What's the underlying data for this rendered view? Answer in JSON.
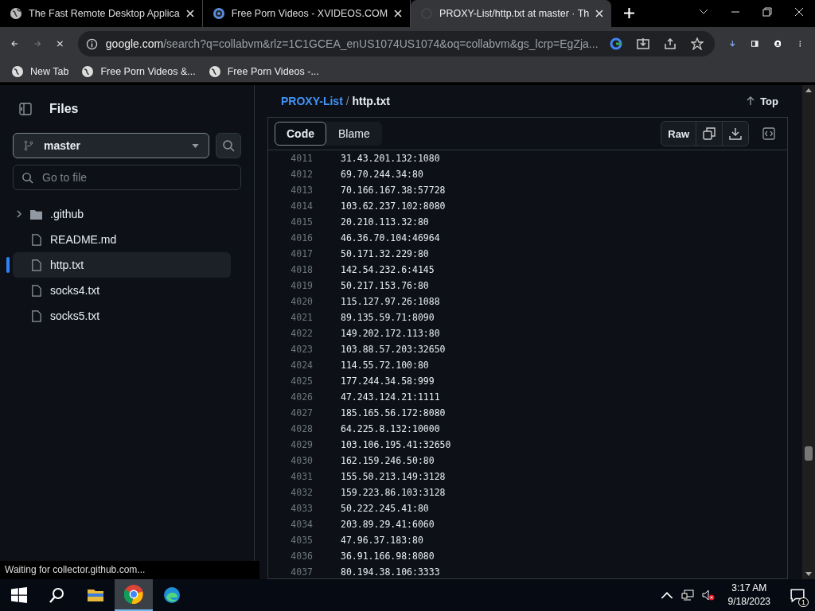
{
  "browser": {
    "tabs": [
      {
        "title": "The Fast Remote Desktop Applica",
        "selected": false,
        "kind": "globe"
      },
      {
        "title": "Free Porn Videos - XVIDEOS.COM",
        "selected": false,
        "kind": "site"
      },
      {
        "title": "PROXY-List/http.txt at master · Th",
        "selected": true,
        "kind": "loading"
      }
    ],
    "address": {
      "host": "google.com",
      "path": "/search?q=collabvm&rlz=1C1GCEA_enUS1074US1074&oq=collabvm&gs_lcrp=EgZja..."
    },
    "bookmarks": [
      "New Tab",
      "Free Porn Videos &...",
      "Free Porn Videos -..."
    ],
    "status": "Waiting for collector.github.com..."
  },
  "sidebar": {
    "title": "Files",
    "branch": "master",
    "search_placeholder": "Go to file",
    "items": [
      {
        "name": ".github",
        "kind": "folder",
        "selected": false,
        "expanded": false
      },
      {
        "name": "README.md",
        "kind": "file",
        "selected": false
      },
      {
        "name": "http.txt",
        "kind": "file",
        "selected": true
      },
      {
        "name": "socks4.txt",
        "kind": "file",
        "selected": false
      },
      {
        "name": "socks5.txt",
        "kind": "file",
        "selected": false
      }
    ]
  },
  "file": {
    "repo": "PROXY-List",
    "separator": "/",
    "name": "http.txt",
    "top": "Top",
    "views": [
      {
        "label": "Code",
        "selected": true
      },
      {
        "label": "Blame",
        "selected": false
      }
    ],
    "raw": "Raw",
    "lines": [
      {
        "n": "4011",
        "t": "31.43.201.132:1080"
      },
      {
        "n": "4012",
        "t": "69.70.244.34:80"
      },
      {
        "n": "4013",
        "t": "70.166.167.38:57728"
      },
      {
        "n": "4014",
        "t": "103.62.237.102:8080"
      },
      {
        "n": "4015",
        "t": "20.210.113.32:80"
      },
      {
        "n": "4016",
        "t": "46.36.70.104:46964"
      },
      {
        "n": "4017",
        "t": "50.171.32.229:80"
      },
      {
        "n": "4018",
        "t": "142.54.232.6:4145"
      },
      {
        "n": "4019",
        "t": "50.217.153.76:80"
      },
      {
        "n": "4020",
        "t": "115.127.97.26:1088"
      },
      {
        "n": "4021",
        "t": "89.135.59.71:8090"
      },
      {
        "n": "4022",
        "t": "149.202.172.113:80"
      },
      {
        "n": "4023",
        "t": "103.88.57.203:32650"
      },
      {
        "n": "4024",
        "t": "114.55.72.100:80"
      },
      {
        "n": "4025",
        "t": "177.244.34.58:999"
      },
      {
        "n": "4026",
        "t": "47.243.124.21:1111"
      },
      {
        "n": "4027",
        "t": "185.165.56.172:8080"
      },
      {
        "n": "4028",
        "t": "64.225.8.132:10000"
      },
      {
        "n": "4029",
        "t": "103.106.195.41:32650"
      },
      {
        "n": "4030",
        "t": "162.159.246.50:80"
      },
      {
        "n": "4031",
        "t": "155.50.213.149:3128"
      },
      {
        "n": "4032",
        "t": "159.223.86.103:3128"
      },
      {
        "n": "4033",
        "t": "50.222.245.41:80"
      },
      {
        "n": "4034",
        "t": "203.89.29.41:6060"
      },
      {
        "n": "4035",
        "t": "47.96.37.183:80"
      },
      {
        "n": "4036",
        "t": "36.91.166.98:8080"
      },
      {
        "n": "4037",
        "t": "80.194.38.106:3333"
      }
    ]
  },
  "taskbar": {
    "time": "3:17 AM",
    "date": "9/18/2023",
    "notifications": "1"
  }
}
